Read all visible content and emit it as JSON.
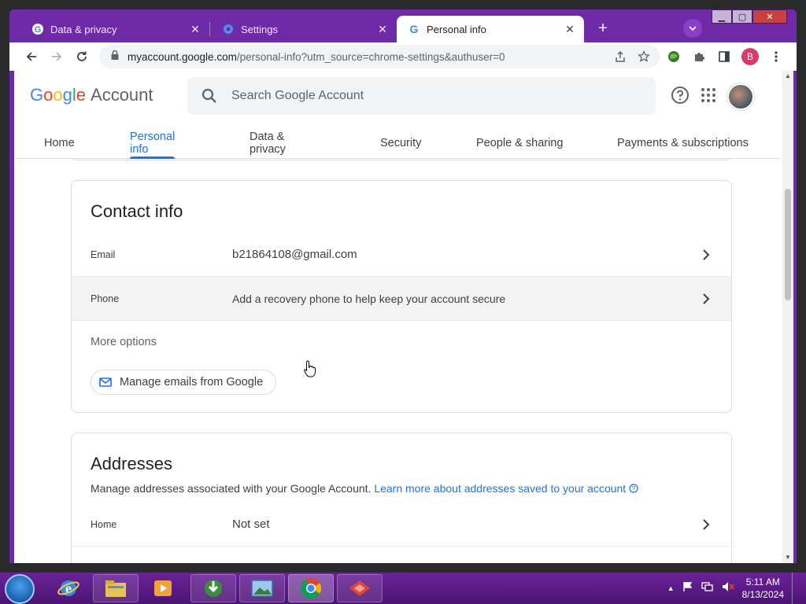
{
  "browser": {
    "tabs": [
      {
        "title": "Data & privacy",
        "icon": "google-g-icon"
      },
      {
        "title": "Settings",
        "icon": "settings-gear-icon"
      },
      {
        "title": "Personal info",
        "icon": "google-g-icon",
        "active": true
      }
    ],
    "url_domain": "myaccount.google.com",
    "url_path": "/personal-info?utm_source=chrome-settings&authuser=0",
    "profile_initial": "B"
  },
  "account_header": {
    "logo_google": [
      "G",
      "o",
      "o",
      "g",
      "l",
      "e"
    ],
    "logo_account": "Account",
    "search_placeholder": "Search Google Account",
    "nav_tabs": [
      "Home",
      "Personal info",
      "Data & privacy",
      "Security",
      "People & sharing",
      "Payments & subscriptions"
    ],
    "active_tab": "Personal info"
  },
  "contact_info": {
    "title": "Contact info",
    "rows": [
      {
        "label": "Email",
        "value": "b21864108@gmail.com"
      },
      {
        "label": "Phone",
        "value": "Add a recovery phone to help keep your account secure"
      }
    ],
    "more_options": "More options",
    "manage_emails_button": "Manage emails from Google"
  },
  "addresses": {
    "title": "Addresses",
    "description": "Manage addresses associated with your Google Account.",
    "learn_more_link": "Learn more about addresses saved to your account",
    "rows": [
      {
        "label": "Home",
        "value": "Not set"
      }
    ]
  },
  "taskbar": {
    "time": "5:11 AM",
    "date": "8/13/2024"
  },
  "colors": {
    "window_frame": "#6f2aa8",
    "link_blue": "#1a73e8",
    "google_blue": "#4285f4",
    "google_red": "#ea4335",
    "google_yellow": "#fbbc05",
    "google_green": "#34a853"
  }
}
